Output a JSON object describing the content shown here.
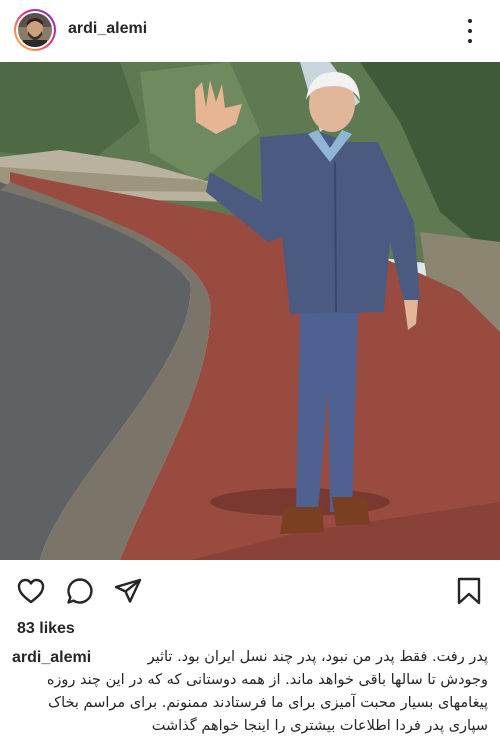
{
  "post": {
    "username": "ardi_alemi",
    "likes": "83 likes",
    "caption_user": "ardi_alemi",
    "caption_text": "پدر رفت. فقط پدر من نبود، پدر چند نسل ایران بود. تاثیر وجودش تا سالها باقی خواهد ماند. از همه دوستانی که که در این چند روزه پیغامهای بسیار محبت آمیزی برای ما فرستادند ممنونم. برای مراسم بخاک سپاری پدر فردا اطلاعات بیشتری را اینجا خواهم گذاشت"
  },
  "icons": {
    "more": "more-options-icon",
    "like": "heart-icon",
    "comment": "comment-icon",
    "share": "share-icon",
    "save": "bookmark-icon"
  },
  "colors": {
    "text": "#262626",
    "path": "#9a4b3f",
    "sky": "#dfe8ef",
    "jacket": "#4b5a80"
  }
}
